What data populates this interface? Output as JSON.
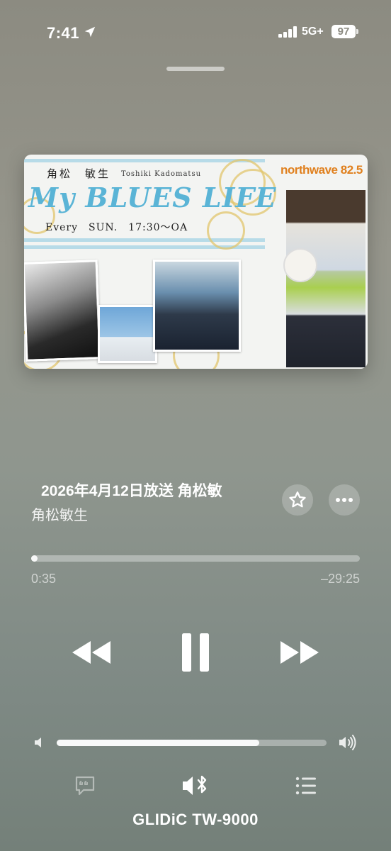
{
  "status_bar": {
    "time": "7:41",
    "network": "5G+",
    "battery": "97"
  },
  "artwork": {
    "name_jp": "角松　敏生",
    "name_en": "Toshiki Kadomatsu",
    "title": "My BLUES LIFE",
    "schedule": "Every　SUN.　17:30～OA",
    "station_logo": "northwave 82.5"
  },
  "track": {
    "title": "2026年4月12日放送 角松敏",
    "artist": "角松敏生"
  },
  "playback": {
    "elapsed": "0:35",
    "remaining": "–29:25",
    "progress_fraction": 0.02,
    "volume_fraction": 0.75
  },
  "output": {
    "device_name": "GLIDiC TW-9000"
  },
  "icons": {
    "location": "location-arrow-icon",
    "favorite": "star-icon",
    "more": "ellipsis-icon",
    "rewind": "rewind-icon",
    "pause": "pause-icon",
    "fast_forward": "fast-forward-icon",
    "volume_low": "speaker-low-icon",
    "volume_high": "speaker-high-icon",
    "lyrics": "lyrics-bubble-icon",
    "airplay": "bluetooth-speaker-icon",
    "queue": "queue-list-icon"
  },
  "colors": {
    "accent_blue": "#5ab4d6",
    "logo_orange": "#e0801e"
  }
}
